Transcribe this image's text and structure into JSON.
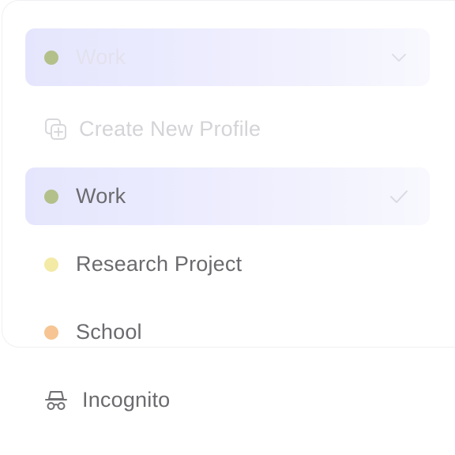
{
  "dropdown": {
    "selected_label": "Work",
    "selected_dot_color": "#b3c08a",
    "chevron": "chevron-down-icon"
  },
  "menu": {
    "create": {
      "label": "Create New Profile",
      "icon": "add-profile-icon"
    },
    "items": [
      {
        "label": "Work",
        "dot_color": "#b3c08a",
        "selected": true,
        "check": "checkmark-icon"
      },
      {
        "label": "Research Project",
        "dot_color": "#f3eaa6"
      },
      {
        "label": "School",
        "dot_color": "#f6c593"
      },
      {
        "label": "Incognito",
        "icon": "incognito-icon"
      }
    ]
  },
  "colors": {
    "selected_bg": "#e5e6fd",
    "text": "#6b6b6f",
    "ghost_text": "#d4d4d8"
  }
}
